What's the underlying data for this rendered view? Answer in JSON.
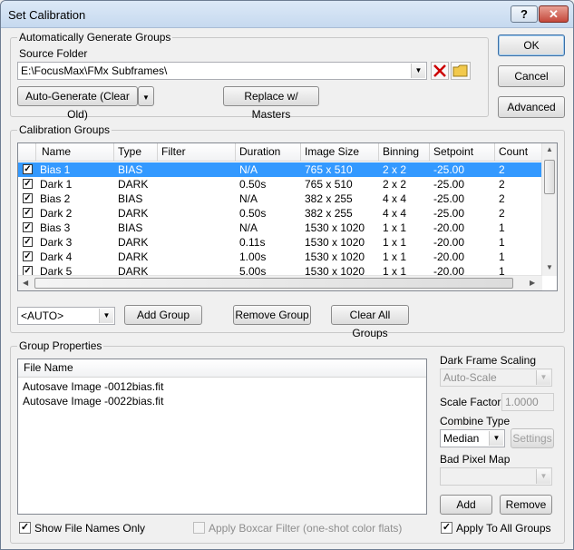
{
  "window": {
    "title": "Set Calibration",
    "help_glyph": "?",
    "close_glyph": "✕"
  },
  "auto_group": {
    "title": "Automatically Generate Groups",
    "source_label": "Source Folder",
    "source_value": "E:\\FocusMax\\FMx Subframes\\",
    "auto_generate_label": "Auto-Generate (Clear Old)",
    "replace_label": "Replace w/ Masters"
  },
  "side_buttons": {
    "ok": "OK",
    "cancel": "Cancel",
    "advanced": "Advanced"
  },
  "calibration": {
    "title": "Calibration Groups",
    "columns": [
      "Name",
      "Type",
      "Filter",
      "Duration",
      "Image Size",
      "Binning",
      "Setpoint",
      "Count"
    ],
    "rows": [
      {
        "name": "Bias 1",
        "type": "BIAS",
        "filter": "",
        "duration": "N/A",
        "size": "765 x 510",
        "binning": "2 x 2",
        "setpoint": "-25.00",
        "count": "2",
        "checked": "✓"
      },
      {
        "name": "Dark 1",
        "type": "DARK",
        "filter": "",
        "duration": "0.50s",
        "size": "765 x 510",
        "binning": "2 x 2",
        "setpoint": "-25.00",
        "count": "2",
        "checked": "✓"
      },
      {
        "name": "Bias 2",
        "type": "BIAS",
        "filter": "",
        "duration": "N/A",
        "size": "382 x 255",
        "binning": "4 x 4",
        "setpoint": "-25.00",
        "count": "2",
        "checked": "✓"
      },
      {
        "name": "Dark 2",
        "type": "DARK",
        "filter": "",
        "duration": "0.50s",
        "size": "382 x 255",
        "binning": "4 x 4",
        "setpoint": "-25.00",
        "count": "2",
        "checked": "✓"
      },
      {
        "name": "Bias 3",
        "type": "BIAS",
        "filter": "",
        "duration": "N/A",
        "size": "1530 x 1020",
        "binning": "1 x 1",
        "setpoint": "-20.00",
        "count": "1",
        "checked": "✓"
      },
      {
        "name": "Dark 3",
        "type": "DARK",
        "filter": "",
        "duration": "0.11s",
        "size": "1530 x 1020",
        "binning": "1 x 1",
        "setpoint": "-20.00",
        "count": "1",
        "checked": "✓"
      },
      {
        "name": "Dark 4",
        "type": "DARK",
        "filter": "",
        "duration": "1.00s",
        "size": "1530 x 1020",
        "binning": "1 x 1",
        "setpoint": "-20.00",
        "count": "1",
        "checked": "✓"
      },
      {
        "name": "Dark 5",
        "type": "DARK",
        "filter": "",
        "duration": "5.00s",
        "size": "1530 x 1020",
        "binning": "1 x 1",
        "setpoint": "-20.00",
        "count": "1",
        "checked": "✓"
      }
    ],
    "auto_select": "<AUTO>",
    "add_group": "Add Group",
    "remove_group": "Remove Group",
    "clear_all": "Clear All Groups"
  },
  "group_props": {
    "title": "Group Properties",
    "file_header": "File Name",
    "files": [
      "Autosave Image -0012bias.fit",
      "Autosave Image -0022bias.fit"
    ],
    "dark_scaling_label": "Dark Frame Scaling",
    "dark_scaling_value": "Auto-Scale",
    "scale_factor_label": "Scale Factor",
    "scale_factor_value": "1.0000",
    "combine_label": "Combine Type",
    "combine_value": "Median",
    "settings_label": "Settings",
    "bad_pixel_label": "Bad Pixel Map",
    "bad_pixel_value": "",
    "add_label": "Add",
    "remove_label": "Remove",
    "show_names_label": "Show File Names Only",
    "boxcar_label": "Apply Boxcar Filter (one-shot color flats)",
    "apply_all_label": "Apply To All Groups",
    "check_glyph": "✓"
  },
  "colors": {
    "selection": "#3399ff",
    "delete_red": "#cc0000",
    "folder_yellow": "#f2c94c"
  }
}
